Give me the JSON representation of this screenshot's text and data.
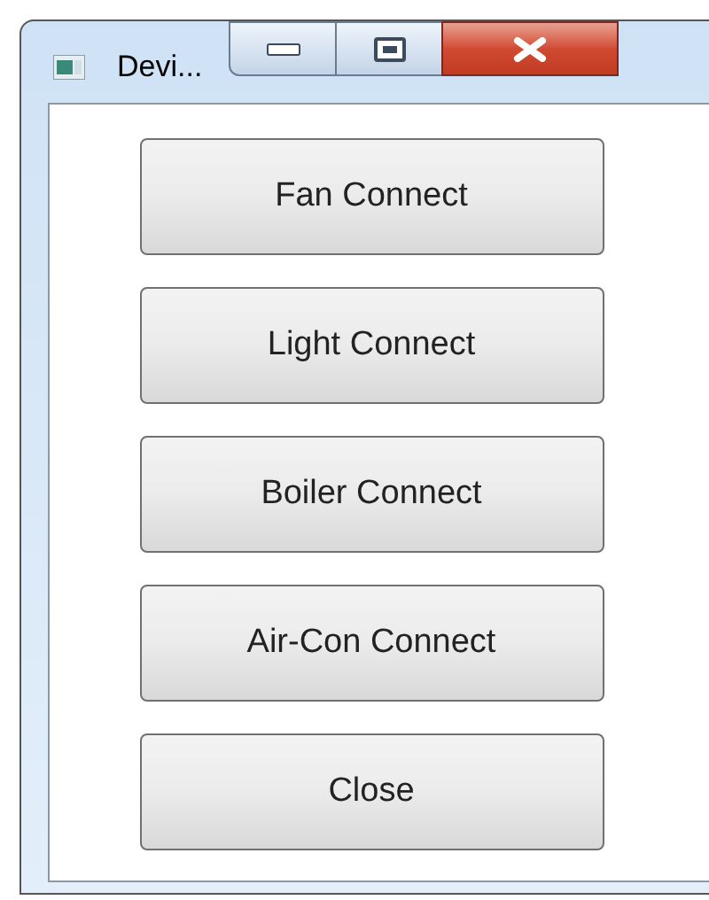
{
  "window": {
    "title": "Devi..."
  },
  "buttons": [
    {
      "label": "Fan Connect"
    },
    {
      "label": "Light Connect"
    },
    {
      "label": "Boiler Connect"
    },
    {
      "label": "Air-Con Connect"
    },
    {
      "label": "Close"
    }
  ]
}
